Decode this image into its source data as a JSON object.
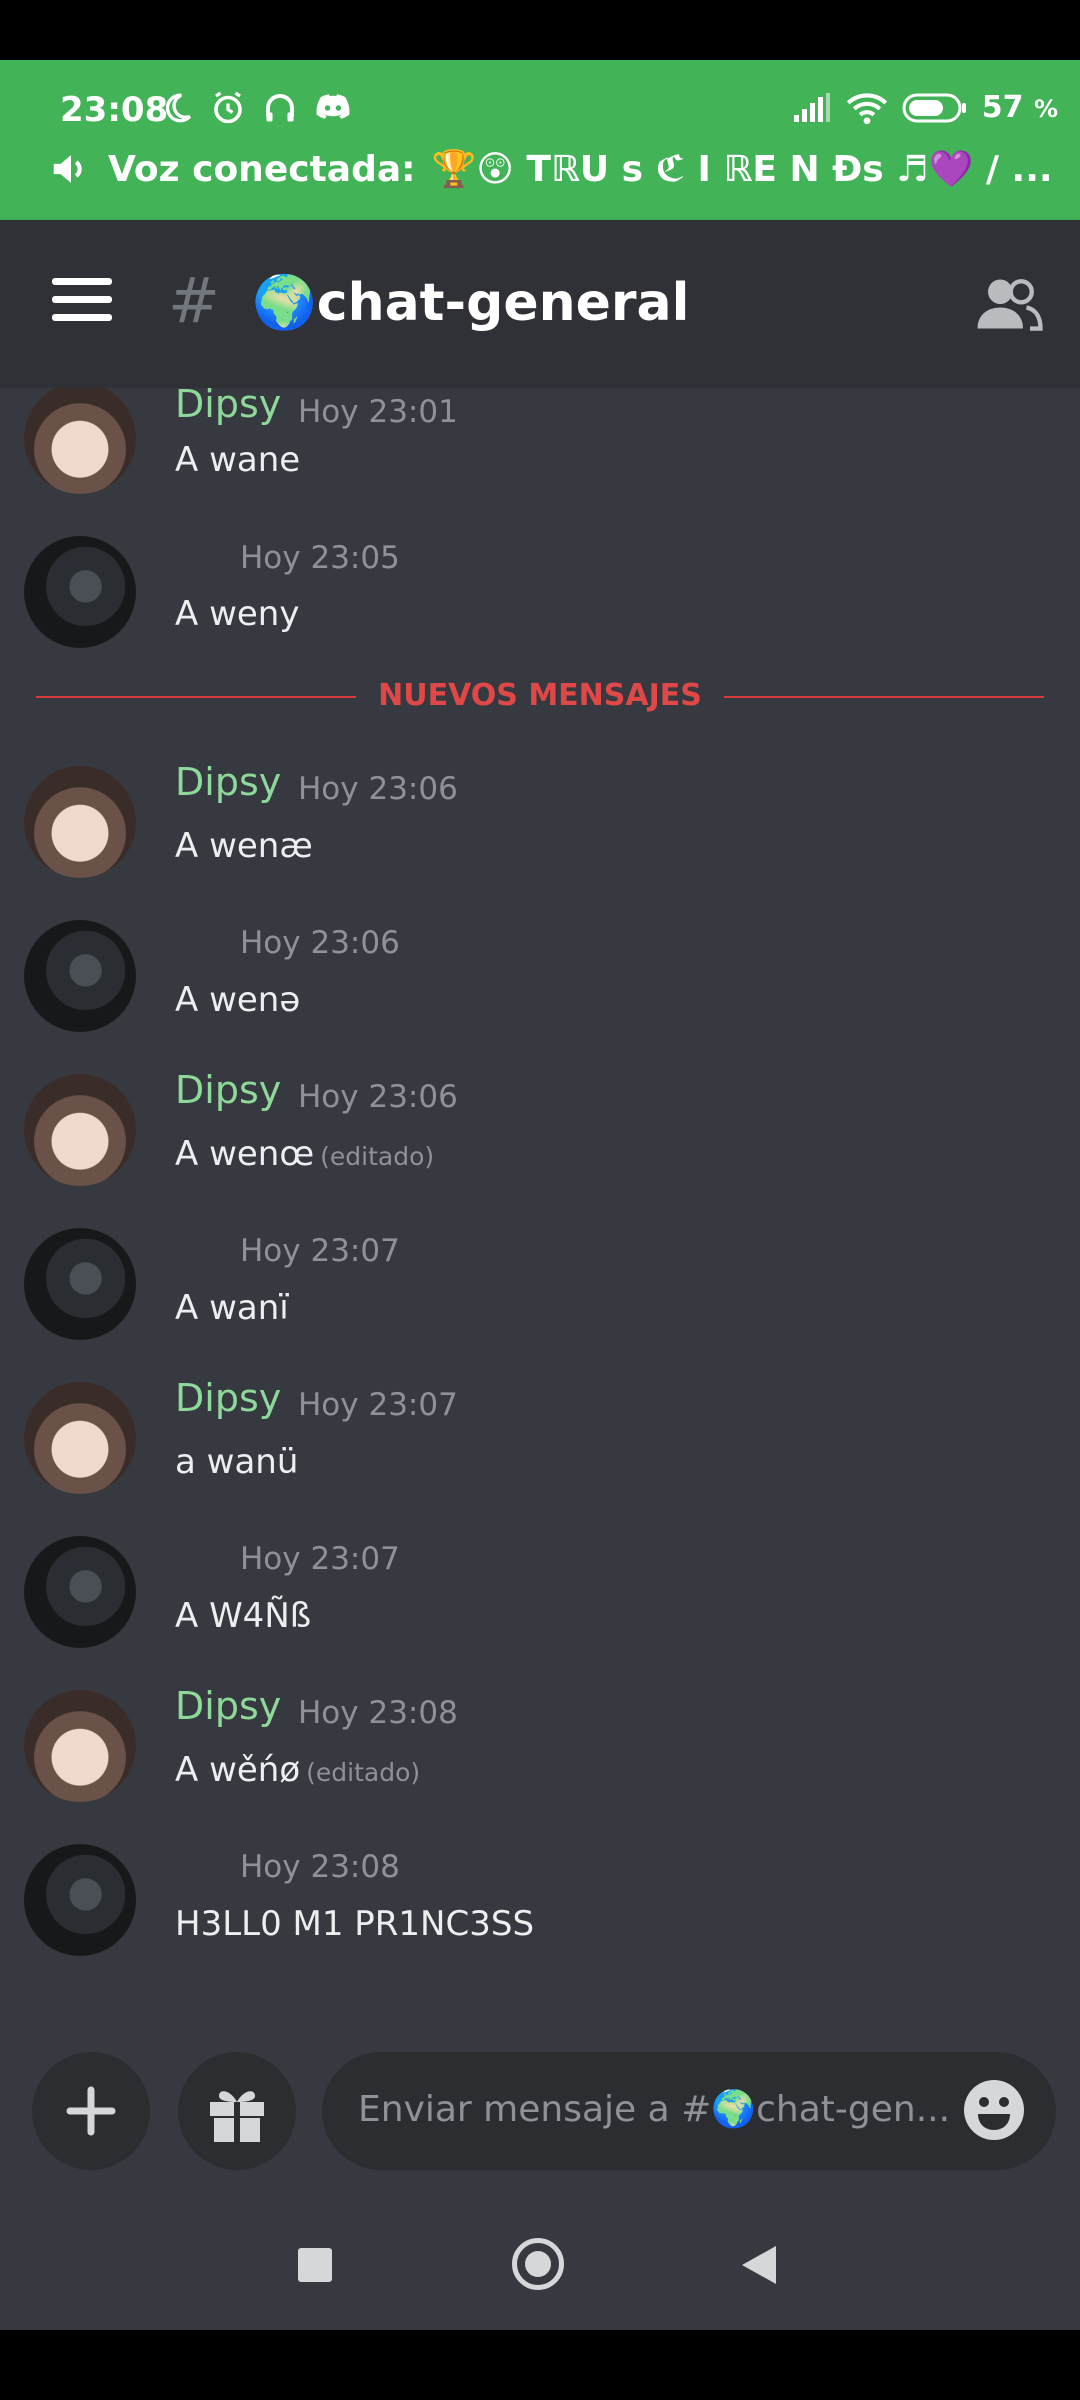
{
  "status_bar": {
    "time": "23:08",
    "battery": "57",
    "battery_unit": "%",
    "voice_label": "Voz conectada:",
    "voice_channel": "🏆😲 TℝU s ℭ I ℝE N Ðs ♬💜 / ..."
  },
  "header": {
    "hash": "#",
    "channel_name": "🌍chat-general"
  },
  "divider": {
    "label": "NUEVOS MENSAJES"
  },
  "messages": [
    {
      "author": "Dipsy",
      "time": "Hoy 23:01",
      "text": "A wane",
      "edited": ""
    },
    {
      "author": "",
      "time": "Hoy 23:05",
      "text": "A weny",
      "edited": ""
    },
    {
      "author": "Dipsy",
      "time": "Hoy 23:06",
      "text": "A wenæ",
      "edited": ""
    },
    {
      "author": "",
      "time": "Hoy 23:06",
      "text": "A wenə",
      "edited": ""
    },
    {
      "author": "Dipsy",
      "time": "Hoy 23:06",
      "text": "A wenœ",
      "edited": "(editado)"
    },
    {
      "author": "",
      "time": "Hoy 23:07",
      "text": "A wanï",
      "edited": ""
    },
    {
      "author": "Dipsy",
      "time": "Hoy 23:07",
      "text": "a wanü",
      "edited": ""
    },
    {
      "author": "",
      "time": "Hoy 23:07",
      "text": "A W4Ñß",
      "edited": ""
    },
    {
      "author": "Dipsy",
      "time": "Hoy 23:08",
      "text": "A wěńø",
      "edited": "(editado)"
    },
    {
      "author": "",
      "time": "Hoy 23:08",
      "text": "H3LL0 M1 PR1NC3SS",
      "edited": ""
    }
  ],
  "composer": {
    "placeholder": "Enviar mensaje a #🌍chat-gen..."
  },
  "colors": {
    "status_green": "#43b358",
    "username_green": "#8ed89a",
    "new_divider_red": "#e04848",
    "chat_bg": "#36393f"
  },
  "icons": {
    "status_left": [
      "moon-icon",
      "alarm-icon",
      "headphones-icon",
      "discord-icon"
    ],
    "status_right": [
      "signal-icon",
      "wifi-icon",
      "battery-icon"
    ],
    "composer": [
      "plus-icon",
      "gift-icon",
      "emoji-icon"
    ],
    "nav": [
      "recents-icon",
      "home-icon",
      "back-icon"
    ]
  }
}
